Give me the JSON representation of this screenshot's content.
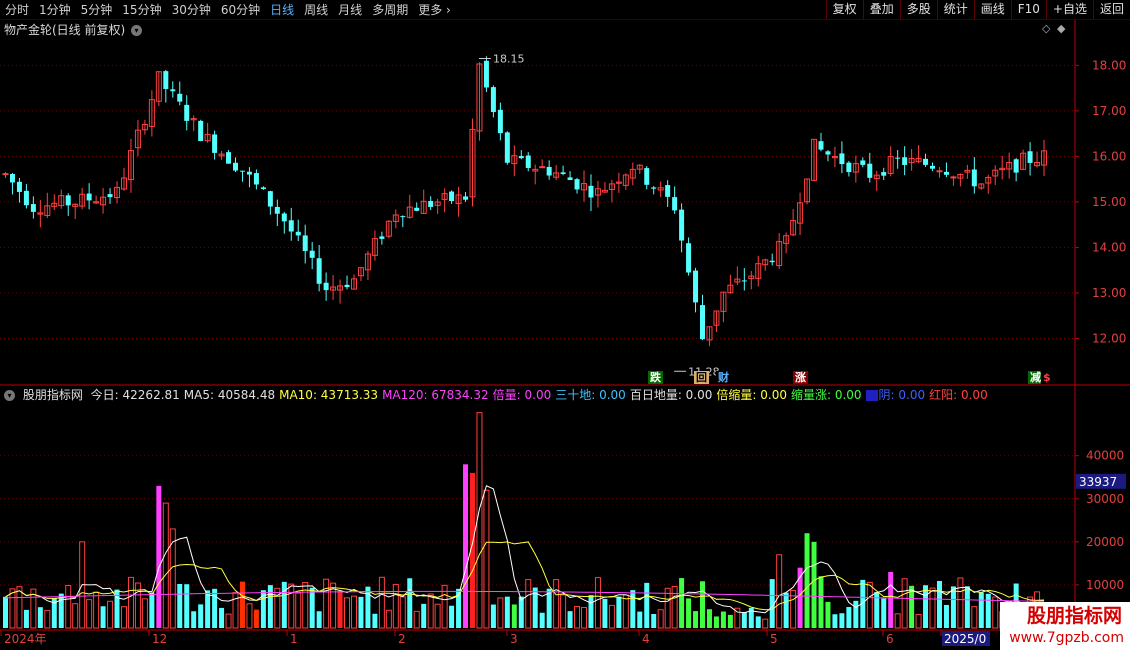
{
  "toolbar": {
    "periods": [
      "分时",
      "1分钟",
      "5分钟",
      "15分钟",
      "30分钟",
      "60分钟",
      "日线",
      "周线",
      "月线",
      "多周期",
      "更多"
    ],
    "active_period": "日线",
    "buttons": [
      "复权",
      "叠加",
      "多股",
      "统计",
      "画线",
      "F10",
      "+自选",
      "返回"
    ],
    "more_icon": "chevron-right-icon"
  },
  "chart": {
    "title": "物产金轮(日线 前复权)",
    "price_axis": [
      "18.00",
      "17.00",
      "16.00",
      "15.00",
      "14.00",
      "13.00",
      "12.00"
    ],
    "price_range": [
      11.0,
      18.6
    ],
    "high_label": "18.15",
    "low_label": "11.28",
    "signals": [
      {
        "text": "跌",
        "color": "#ffffff",
        "bg": "#006a00"
      },
      {
        "text": "回",
        "color": "#000000",
        "bg": "#d8b070"
      },
      {
        "text": "财",
        "color": "#5ab0ff",
        "bg": "#000000"
      },
      {
        "text": "涨",
        "color": "#ffffff",
        "bg": "#8a0000"
      },
      {
        "text": "减",
        "color": "#ffffff",
        "bg": "#006a00"
      },
      {
        "text": "$",
        "color": "#ff4040",
        "bg": "#000000"
      }
    ]
  },
  "indicator": {
    "name": "股朋指标网",
    "fields": [
      {
        "label": "今日:",
        "value": "42262.81",
        "color": "#e0e0e0"
      },
      {
        "label": "MA5:",
        "value": "40584.48",
        "color": "#e0e0e0"
      },
      {
        "label": "MA10:",
        "value": "43713.33",
        "color": "#ffff40"
      },
      {
        "label": "MA120:",
        "value": "67834.32",
        "color": "#ff40ff"
      },
      {
        "label": "倍量:",
        "value": "0.00",
        "color": "#ff40ff"
      },
      {
        "label": "三十地:",
        "value": "0.00",
        "color": "#40c0ff"
      },
      {
        "label": "百日地量:",
        "value": "0.00",
        "color": "#e0e0e0"
      },
      {
        "label": "倍缩量:",
        "value": "0.00",
        "color": "#ffff40"
      },
      {
        "label": "缩量涨:",
        "value": "0.00",
        "color": "#40ff40"
      },
      {
        "label": "阴:",
        "value": "0.00",
        "color": "#4060ff",
        "prefix_icon": "blue-bar-icon"
      },
      {
        "label": "红阳:",
        "value": "0.00",
        "color": "#ff4040"
      }
    ],
    "vol_axis": [
      "40000",
      "30000",
      "20000",
      "10000"
    ],
    "current_value": "33937"
  },
  "time_axis": [
    "2024年",
    "12",
    "1",
    "2",
    "3",
    "4",
    "5",
    "6",
    "2025/0"
  ],
  "watermark": {
    "line1": "股朋指标网",
    "line2": "www.7gpzb.com"
  },
  "colors": {
    "up": "#ff4040",
    "down": "#54ffff",
    "grid": "#6a0000",
    "axis": "#c00000"
  }
}
